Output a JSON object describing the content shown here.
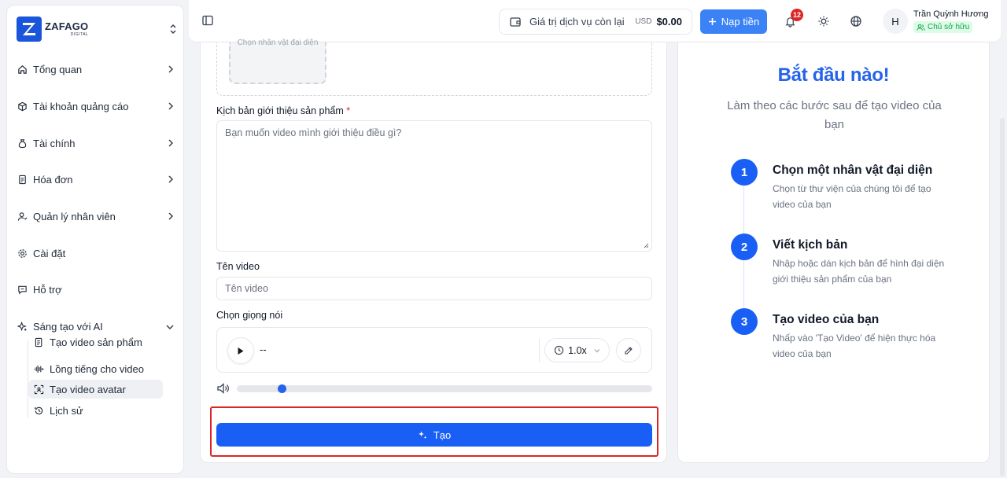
{
  "brand": {
    "name": "ZAFAGO",
    "sub": "DIGITAL",
    "accent": "#1a56db"
  },
  "sidebar": {
    "items": [
      {
        "label": "Tổng quan",
        "icon": "home-icon",
        "has_chevron": true
      },
      {
        "label": "Tài khoản quảng cáo",
        "icon": "box-icon",
        "has_chevron": true
      },
      {
        "label": "Tài chính",
        "icon": "money-bag-icon",
        "has_chevron": true
      },
      {
        "label": "Hóa đơn",
        "icon": "receipt-icon",
        "has_chevron": true
      },
      {
        "label": "Quản lý nhân viên",
        "icon": "user-icon",
        "has_chevron": true
      },
      {
        "label": "Cài đặt",
        "icon": "gear-icon",
        "has_chevron": false
      },
      {
        "label": "Hỗ trợ",
        "icon": "chat-icon",
        "has_chevron": false
      },
      {
        "label": "Sáng tạo với AI",
        "icon": "sparkle-icon",
        "expanded": true
      }
    ],
    "sub_items": [
      {
        "label": "Tạo video sản phẩm",
        "icon": "document-icon"
      },
      {
        "label": "Lồng tiếng cho video",
        "icon": "waveform-icon"
      },
      {
        "label": "Tạo video avatar",
        "icon": "face-scan-icon",
        "active": true
      },
      {
        "label": "Lịch sử",
        "icon": "history-icon"
      }
    ]
  },
  "topbar": {
    "balance_label": "Giá trị dịch vụ còn lại",
    "currency": "USD",
    "balance": "$0.00",
    "topup_label": "Nạp tiền",
    "notification_count": "12",
    "user_initial": "H",
    "user_name": "Trần Quỳnh Hương",
    "user_role": "Chủ sở hữu"
  },
  "form": {
    "avatar_placeholder": "Chọn nhân vật đại diện",
    "script_label": "Kịch bản giới thiệu sản phẩm",
    "required_mark": "*",
    "script_placeholder": "Bạn muốn video mình giới thiệu điều gì?",
    "video_name_label": "Tên video",
    "video_name_placeholder": "Tên video",
    "voice_label": "Chọn giọng nói",
    "voice_name": "--",
    "speed": "1.0x",
    "volume_level": 0.1,
    "create_label": "Tạo"
  },
  "guide": {
    "title": "Bắt đầu nào!",
    "subtitle": "Làm theo các bước sau để tạo video của bạn",
    "steps": [
      {
        "num": "1",
        "title": "Chọn một nhân vật đại diện",
        "desc": "Chọn từ thư viện của chúng tôi để tạo video của bạn"
      },
      {
        "num": "2",
        "title": "Viết kịch bản",
        "desc": "Nhập hoặc dán kịch bản để hình đại diện giới thiệu sản phẩm của bạn"
      },
      {
        "num": "3",
        "title": "Tạo video của bạn",
        "desc": "Nhấp vào 'Tạo Video' để hiện thực hóa video của bạn"
      }
    ]
  },
  "colors": {
    "primary": "#1a5ff5",
    "danger": "#dc2626",
    "success": "#16a34a"
  }
}
